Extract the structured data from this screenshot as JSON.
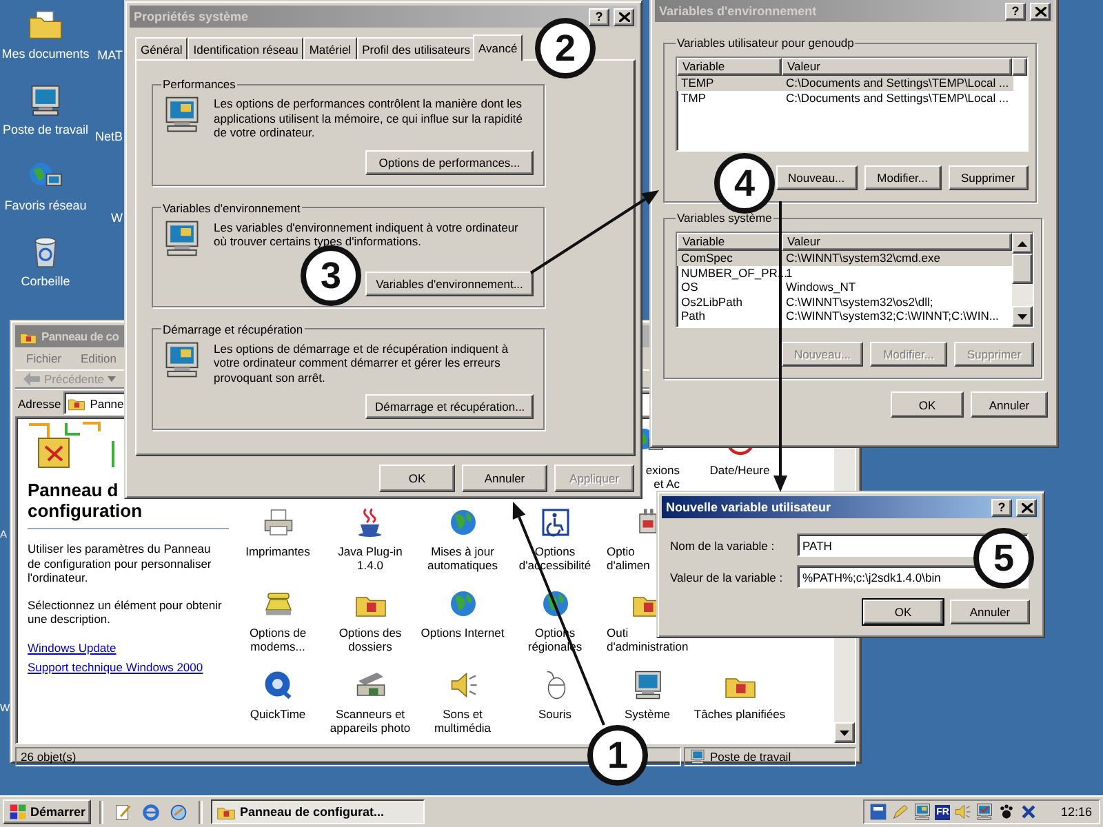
{
  "desktop": {
    "icons": [
      {
        "label": "Mes documents"
      },
      {
        "label": "Poste de travail"
      },
      {
        "label": "Favoris réseau"
      },
      {
        "label": "Corbeille"
      }
    ],
    "icons_behind": [
      "MAT",
      "NetB",
      "W"
    ],
    "labels_left_edge": [
      "A",
      "W"
    ]
  },
  "control_panel": {
    "title": "Panneau de co",
    "active": false,
    "menu": [
      "Fichier",
      "Edition"
    ],
    "back_button": {
      "label": "Précédente",
      "disabled": true
    },
    "address": {
      "label": "Adresse",
      "value": "Panne"
    },
    "heading": [
      "Panneau d",
      "configuration"
    ],
    "description": "Utiliser les paramètres du Panneau de configuration pour personnaliser l'ordinateur.",
    "hint": "Sélectionnez un élément pour obtenir une description.",
    "links": [
      "Windows Update",
      "Support technique Windows 2000"
    ],
    "rows": [
      [
        "",
        "",
        "",
        "",
        "exions\net Ac",
        "Date/Heure"
      ],
      [
        "Imprimantes",
        "Java Plug-in 1.4.0",
        "Mises à jour automatiques",
        "Options d'accessibilité",
        "Optio\nd'alimen"
      ],
      [
        "Options de modems...",
        "Options des dossiers",
        "Options Internet",
        "Options régionales",
        "Outi\nd'administration"
      ],
      [
        "QuickTime",
        "Scanneurs et appareils photo",
        "Sons et multimédia",
        "Souris",
        "Système",
        "Tâches planifiées"
      ]
    ],
    "status": "26 objet(s)",
    "zone": "Poste de travail"
  },
  "system_properties": {
    "title": "Propriétés système",
    "active": false,
    "help_button": "?",
    "tabs": [
      {
        "label": "Général",
        "selected": false
      },
      {
        "label": "Identification réseau",
        "selected": false
      },
      {
        "label": "Matériel",
        "selected": false
      },
      {
        "label": "Profil des utilisateurs",
        "selected": false
      },
      {
        "label": "Avancé",
        "selected": true
      }
    ],
    "groups": [
      {
        "title": "Performances",
        "text": "Les options de performances contrôlent la manière dont les applications utilisent la mémoire, ce qui influe sur la rapidité de votre ordinateur.",
        "button": "Options de performances..."
      },
      {
        "title": "Variables d'environnement",
        "text": "Les variables d'environnement indiquent à votre ordinateur où trouver certains types d'informations.",
        "button": "Variables d'environnement..."
      },
      {
        "title": "Démarrage et récupération",
        "text": "Les options de démarrage et de récupération indiquent à votre ordinateur comment démarrer et gérer les erreurs provoquant son arrêt.",
        "button": "Démarrage et récupération..."
      }
    ],
    "buttons": [
      {
        "label": "OK",
        "disabled": false
      },
      {
        "label": "Annuler",
        "disabled": false
      },
      {
        "label": "Appliquer",
        "disabled": true
      }
    ]
  },
  "environment_variables": {
    "title": "Variables d'environnement",
    "active": false,
    "help_button": "?",
    "user_group": {
      "title": "Variables utilisateur pour genoudp",
      "columns": [
        "Variable",
        "Valeur"
      ],
      "rows": [
        {
          "cells": [
            "TEMP",
            "C:\\Documents and Settings\\TEMP\\Local ..."
          ],
          "selected": true
        },
        {
          "cells": [
            "TMP",
            "C:\\Documents and Settings\\TEMP\\Local ..."
          ],
          "selected": false
        }
      ],
      "buttons": [
        {
          "label": "Nouveau...",
          "disabled": false
        },
        {
          "label": "Modifier...",
          "disabled": false
        },
        {
          "label": "Supprimer",
          "disabled": false
        }
      ]
    },
    "system_group": {
      "title": "Variables système",
      "columns": [
        "Variable",
        "Valeur"
      ],
      "rows": [
        {
          "cells": [
            "ComSpec",
            "C:\\WINNT\\system32\\cmd.exe"
          ],
          "selected": true
        },
        {
          "cells": [
            "NUMBER_OF_PR...",
            "1"
          ],
          "selected": false
        },
        {
          "cells": [
            "OS",
            "Windows_NT"
          ],
          "selected": false
        },
        {
          "cells": [
            "Os2LibPath",
            "C:\\WINNT\\system32\\os2\\dll;"
          ],
          "selected": false
        },
        {
          "cells": [
            "Path",
            "C:\\WINNT\\system32;C:\\WINNT;C:\\WIN..."
          ],
          "selected": false
        }
      ],
      "buttons": [
        {
          "label": "Nouveau...",
          "disabled": true
        },
        {
          "label": "Modifier...",
          "disabled": true
        },
        {
          "label": "Supprimer",
          "disabled": true
        }
      ]
    },
    "buttons": [
      {
        "label": "OK",
        "disabled": false
      },
      {
        "label": "Annuler",
        "disabled": false
      }
    ]
  },
  "new_variable": {
    "title": "Nouvelle variable utilisateur",
    "active": true,
    "help_button": "?",
    "fields": [
      {
        "label": "Nom de la variable :",
        "value": "PATH"
      },
      {
        "label": "Valeur de la variable :",
        "value": "%PATH%;c:\\j2sdk1.4.0\\bin"
      }
    ],
    "buttons": [
      {
        "label": "OK",
        "default": true
      },
      {
        "label": "Annuler",
        "default": false
      }
    ]
  },
  "callouts": [
    "1",
    "2",
    "3",
    "4",
    "5"
  ],
  "taskbar": {
    "start": "Démarrer",
    "tasks": [
      {
        "label": "Panneau de configurat...",
        "selected": true
      }
    ],
    "language": "FR",
    "clock": "12:16"
  }
}
